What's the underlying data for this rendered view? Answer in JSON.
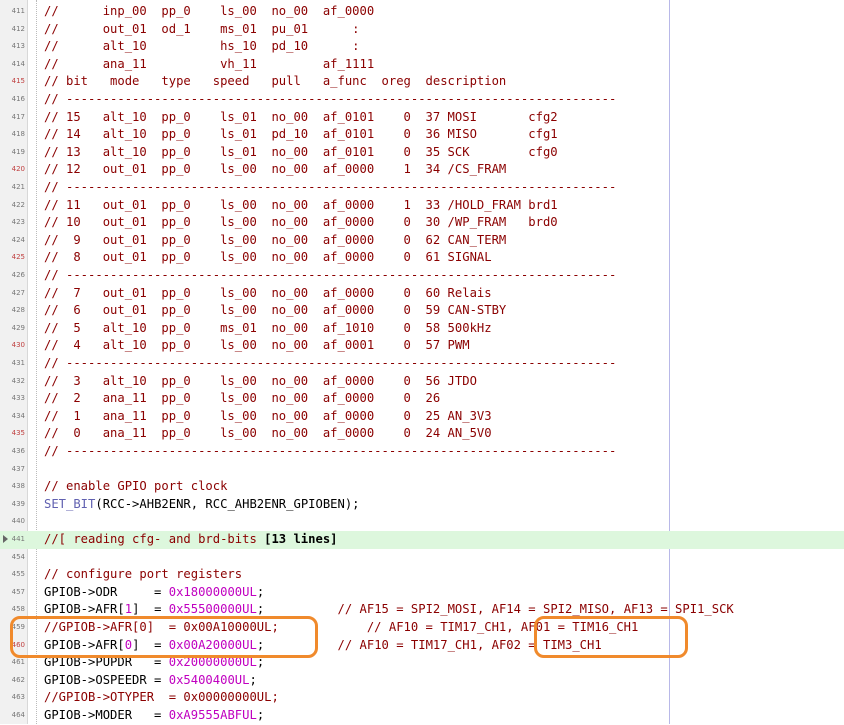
{
  "editor": {
    "lines": [
      {
        "n": "411",
        "parts": [
          [
            "cm",
            "//      inp_00  pp_0    ls_00  no_00  af_0000"
          ]
        ]
      },
      {
        "n": "412",
        "parts": [
          [
            "cm",
            "//      out_01  od_1    ms_01  pu_01      :"
          ]
        ]
      },
      {
        "n": "413",
        "parts": [
          [
            "cm",
            "//      alt_10          hs_10  pd_10      :"
          ]
        ]
      },
      {
        "n": "414",
        "parts": [
          [
            "cm",
            "//      ana_11          vh_11         af_1111"
          ]
        ]
      },
      {
        "n": "415",
        "red": true,
        "parts": [
          [
            "cm",
            "// bit   mode   type   speed   pull   a_func  oreg  description"
          ]
        ]
      },
      {
        "n": "416",
        "parts": [
          [
            "cm",
            "// ---------------------------------------------------------------------------"
          ]
        ]
      },
      {
        "n": "417",
        "parts": [
          [
            "cm",
            "// 15   alt_10  pp_0    ls_01  no_00  af_0101    0  37 MOSI       cfg2"
          ]
        ]
      },
      {
        "n": "418",
        "parts": [
          [
            "cm",
            "// 14   alt_10  pp_0    ls_01  pd_10  af_0101    0  36 MISO       cfg1"
          ]
        ]
      },
      {
        "n": "419",
        "parts": [
          [
            "cm",
            "// 13   alt_10  pp_0    ls_01  no_00  af_0101    0  35 SCK        cfg0"
          ]
        ]
      },
      {
        "n": "420",
        "red": true,
        "parts": [
          [
            "cm",
            "// 12   out_01  pp_0    ls_00  no_00  af_0000    1  34 /CS_FRAM"
          ]
        ]
      },
      {
        "n": "421",
        "parts": [
          [
            "cm",
            "// ---------------------------------------------------------------------------"
          ]
        ]
      },
      {
        "n": "422",
        "parts": [
          [
            "cm",
            "// 11   out_01  pp_0    ls_00  no_00  af_0000    1  33 /HOLD_FRAM brd1"
          ]
        ]
      },
      {
        "n": "423",
        "parts": [
          [
            "cm",
            "// 10   out_01  pp_0    ls_00  no_00  af_0000    0  30 /WP_FRAM   brd0"
          ]
        ]
      },
      {
        "n": "424",
        "parts": [
          [
            "cm",
            "//  9   out_01  pp_0    ls_00  no_00  af_0000    0  62 CAN_TERM"
          ]
        ]
      },
      {
        "n": "425",
        "red": true,
        "parts": [
          [
            "cm",
            "//  8   out_01  pp_0    ls_00  no_00  af_0000    0  61 SIGNAL"
          ]
        ]
      },
      {
        "n": "426",
        "parts": [
          [
            "cm",
            "// ---------------------------------------------------------------------------"
          ]
        ]
      },
      {
        "n": "427",
        "parts": [
          [
            "cm",
            "//  7   out_01  pp_0    ls_00  no_00  af_0000    0  60 Relais"
          ]
        ]
      },
      {
        "n": "428",
        "parts": [
          [
            "cm",
            "//  6   out_01  pp_0    ls_00  no_00  af_0000    0  59 CAN-STBY"
          ]
        ]
      },
      {
        "n": "429",
        "parts": [
          [
            "cm",
            "//  5   alt_10  pp_0    ms_01  no_00  af_1010    0  58 500kHz"
          ]
        ]
      },
      {
        "n": "430",
        "red": true,
        "parts": [
          [
            "cm",
            "//  4   alt_10  pp_0    ls_00  no_00  af_0001    0  57 PWM"
          ]
        ]
      },
      {
        "n": "431",
        "parts": [
          [
            "cm",
            "// ---------------------------------------------------------------------------"
          ]
        ]
      },
      {
        "n": "432",
        "parts": [
          [
            "cm",
            "//  3   alt_10  pp_0    ls_00  no_00  af_0000    0  56 JTDO"
          ]
        ]
      },
      {
        "n": "433",
        "parts": [
          [
            "cm",
            "//  2   ana_11  pp_0    ls_00  no_00  af_0000    0  26"
          ]
        ]
      },
      {
        "n": "434",
        "parts": [
          [
            "cm",
            "//  1   ana_11  pp_0    ls_00  no_00  af_0000    0  25 AN_3V3"
          ]
        ]
      },
      {
        "n": "435",
        "red": true,
        "parts": [
          [
            "cm",
            "//  0   ana_11  pp_0    ls_00  no_00  af_0000    0  24 AN_5V0"
          ]
        ]
      },
      {
        "n": "436",
        "parts": [
          [
            "cm",
            "// ---------------------------------------------------------------------------"
          ]
        ]
      },
      {
        "n": "437",
        "parts": [
          [
            "bl",
            ""
          ]
        ]
      },
      {
        "n": "438",
        "parts": [
          [
            "cm",
            "// enable GPIO port clock"
          ]
        ]
      },
      {
        "n": "439",
        "parts": [
          [
            "kw",
            "SET_BIT"
          ],
          [
            "bl",
            "(RCC->AHB2ENR, RCC_AHB2ENR_GPIOBEN);"
          ]
        ]
      },
      {
        "n": "440",
        "parts": [
          [
            "bl",
            ""
          ]
        ]
      },
      {
        "n": "441",
        "hl": true,
        "fold": true,
        "parts": [
          [
            "cm",
            "//[ reading cfg- and brd-bits "
          ],
          [
            "bold",
            "[13 lines]"
          ]
        ]
      },
      {
        "n": "454",
        "parts": [
          [
            "bl",
            ""
          ]
        ]
      },
      {
        "n": "455",
        "parts": [
          [
            "cm",
            "// configure port registers"
          ]
        ]
      },
      {
        "n": "457",
        "parts": [
          [
            "bl",
            "GPIOB->ODR     = "
          ],
          [
            "num",
            "0x18000000UL"
          ],
          [
            "bl",
            ";"
          ]
        ]
      },
      {
        "n": "458",
        "parts": [
          [
            "bl",
            "GPIOB->AFR["
          ],
          [
            "num",
            "1"
          ],
          [
            "bl",
            "]  = "
          ],
          [
            "num",
            "0x55500000UL"
          ],
          [
            "bl",
            ";          "
          ],
          [
            "cm",
            "// AF15 = SPI2_MOSI, AF14 = SPI2_MISO, AF13 = SPI1_SCK"
          ]
        ]
      },
      {
        "n": "459",
        "parts": [
          [
            "cm",
            "//GPIOB->AFR[0]  = 0x00A10000UL;            // AF10 = TIM17_CH1, AF01 = TIM16_CH1"
          ]
        ]
      },
      {
        "n": "460",
        "red": true,
        "parts": [
          [
            "bl",
            "GPIOB->AFR["
          ],
          [
            "num",
            "0"
          ],
          [
            "bl",
            "]  = "
          ],
          [
            "num",
            "0x00A20000UL"
          ],
          [
            "bl",
            ";          "
          ],
          [
            "cm",
            "// AF10 = TIM17_CH1, AF02 = TIM3_CH1"
          ]
        ]
      },
      {
        "n": "461",
        "parts": [
          [
            "bl",
            "GPIOB->PUPDR   = "
          ],
          [
            "num",
            "0x20000000UL"
          ],
          [
            "bl",
            ";"
          ]
        ]
      },
      {
        "n": "462",
        "parts": [
          [
            "bl",
            "GPIOB->OSPEEDR = "
          ],
          [
            "num",
            "0x5400400UL"
          ],
          [
            "bl",
            ";"
          ]
        ]
      },
      {
        "n": "463",
        "parts": [
          [
            "cm",
            "//GPIOB->OTYPER  = 0x00000000UL;"
          ]
        ]
      },
      {
        "n": "464",
        "parts": [
          [
            "bl",
            "GPIOB->MODER   = "
          ],
          [
            "num",
            "0xA9555ABFUL"
          ],
          [
            "bl",
            ";"
          ]
        ]
      }
    ]
  }
}
